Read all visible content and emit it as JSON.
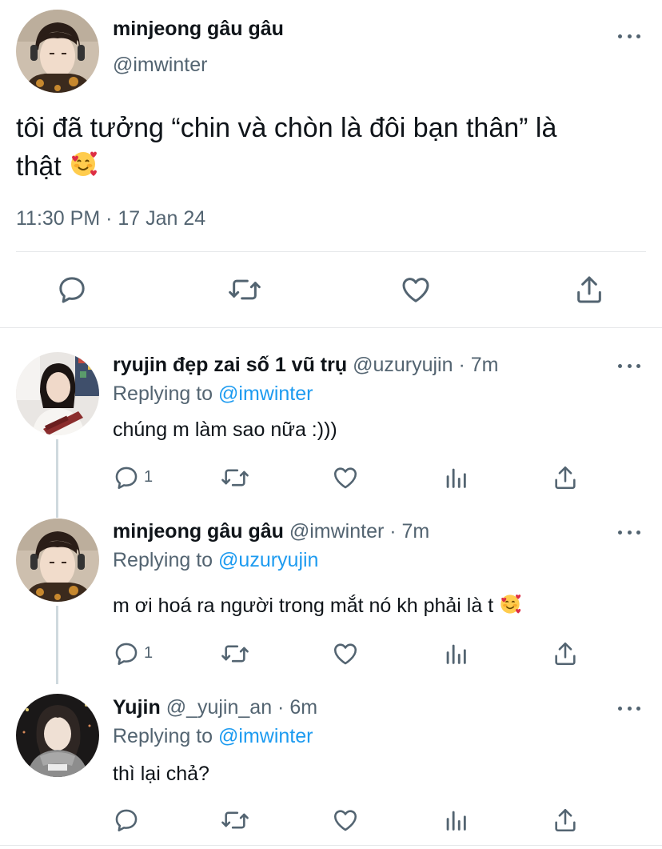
{
  "main_tweet": {
    "display_name": "minjeong gâu gâu",
    "handle": "@imwinter",
    "text_line1": "tôi đã tưởng “chin và chòn là đôi bạn thân” là",
    "text_line2": "thật",
    "emoji": "smiling-face-with-hearts",
    "timestamp": "11:30 PM · 17 Jan 24"
  },
  "replies": [
    {
      "display_name": "ryujin đẹp zai số 1 vũ trụ",
      "handle": "@uzuryujin",
      "time": " · 7m",
      "replying_to_label": "Replying to",
      "replying_to": "@imwinter",
      "text": "chúng m làm sao nữa :)))",
      "reply_count": "1"
    },
    {
      "display_name": "minjeong gâu gâu",
      "handle": "@imwinter",
      "time": " · 7m",
      "replying_to_label": "Replying to",
      "replying_to": "@uzuryujin",
      "text": "m ơi hoá ra người trong mắt nó kh phải là t",
      "emoji": "smiling-face-with-hearts",
      "reply_count": "1"
    },
    {
      "display_name": "Yujin",
      "handle": "@_yujin_an",
      "time": " · 6m",
      "replying_to_label": "Replying to",
      "replying_to": "@imwinter",
      "text": "thì lại chả?",
      "reply_count": ""
    }
  ],
  "colors": {
    "link": "#1d9bf0",
    "muted": "#536471",
    "text": "#0f1419",
    "divider": "#e6e8ea",
    "thread_line": "#cfd9de"
  }
}
